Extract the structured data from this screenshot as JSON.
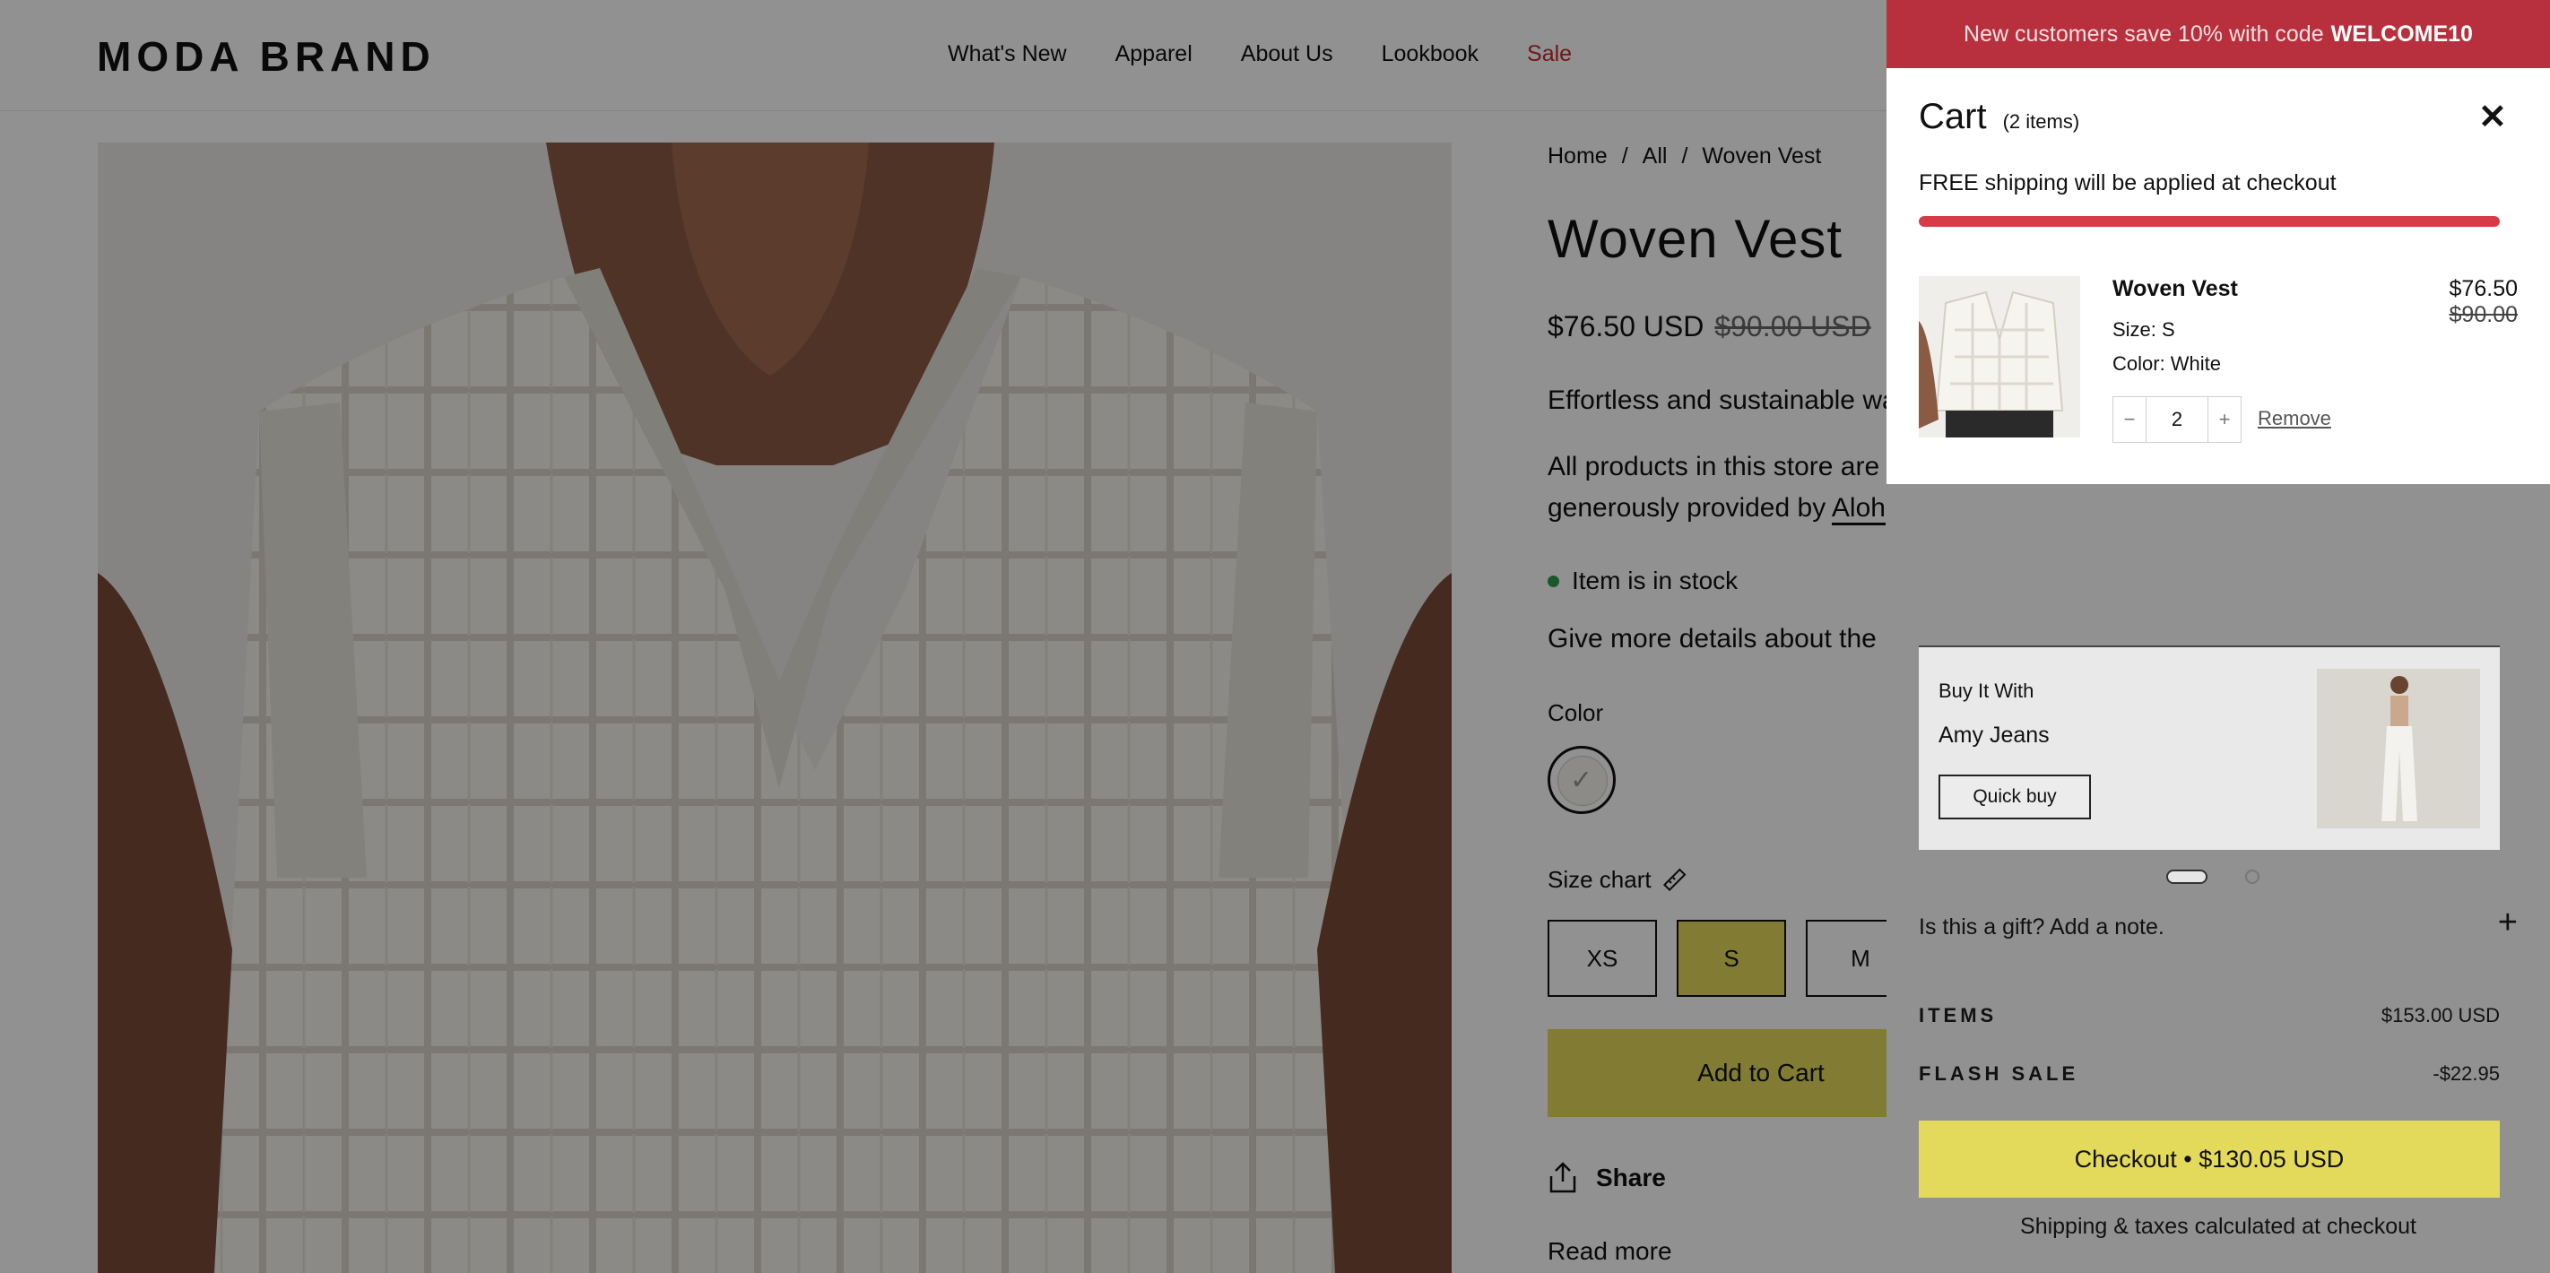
{
  "brand": {
    "logo": "MODA BRAND"
  },
  "nav": {
    "items": [
      "What's New",
      "Apparel",
      "About Us",
      "Lookbook"
    ],
    "sale": "Sale"
  },
  "breadcrumb": [
    "Home",
    "/",
    "All",
    "/",
    "Woven Vest"
  ],
  "product": {
    "title": "Woven Vest",
    "price": "$76.50 USD",
    "compare_price": "$90.00 USD",
    "desc_line1": "Effortless and sustainable wa",
    "desc_line2": "All products in this store are",
    "desc_line3_prefix": "generously provided by",
    "desc_line3_link": "Aloh",
    "stock": "Item is in stock",
    "details": "Give more details about the",
    "color_label": "Color",
    "size_chart": "Size chart",
    "sizes": [
      "XS",
      "S",
      "M"
    ],
    "selected_size": "S",
    "add_to_cart": "Add to Cart",
    "share": "Share",
    "read_more": "Read more"
  },
  "cart": {
    "announcement": "New customers save 10% with code",
    "announcement_code": "WELCOME10",
    "title": "Cart",
    "count": "(2 items)",
    "shipping_message": "FREE shipping will be applied at checkout",
    "shipping_progress": 1.0,
    "line_item": {
      "name": "Woven Vest",
      "size": "Size: S",
      "color": "Color: White",
      "price": "$76.50",
      "compare_price": "$90.00",
      "quantity": "2",
      "remove": "Remove"
    },
    "upsell": {
      "label": "Buy It With",
      "name": "Amy Jeans",
      "button": "Quick buy"
    },
    "gift_note": "Is this a gift? Add a note.",
    "summary": {
      "items_label": "ITEMS",
      "items_value": "$153.00 USD",
      "discount_label": "FLASH SALE",
      "discount_value": "-$22.95"
    },
    "checkout": "Checkout • $130.05 USD",
    "taxes_note": "Shipping & taxes calculated at checkout"
  },
  "colors": {
    "accent": "#e3d95a",
    "announcement": "#b8303d",
    "sale": "#c62a2a",
    "progress": "#d63b47",
    "in_stock": "#2f9a4b"
  },
  "icons": {
    "close": "close-icon",
    "share": "share-icon",
    "ruler": "ruler-icon",
    "plus": "plus-icon",
    "minus": "minus-icon",
    "check": "check-icon"
  }
}
